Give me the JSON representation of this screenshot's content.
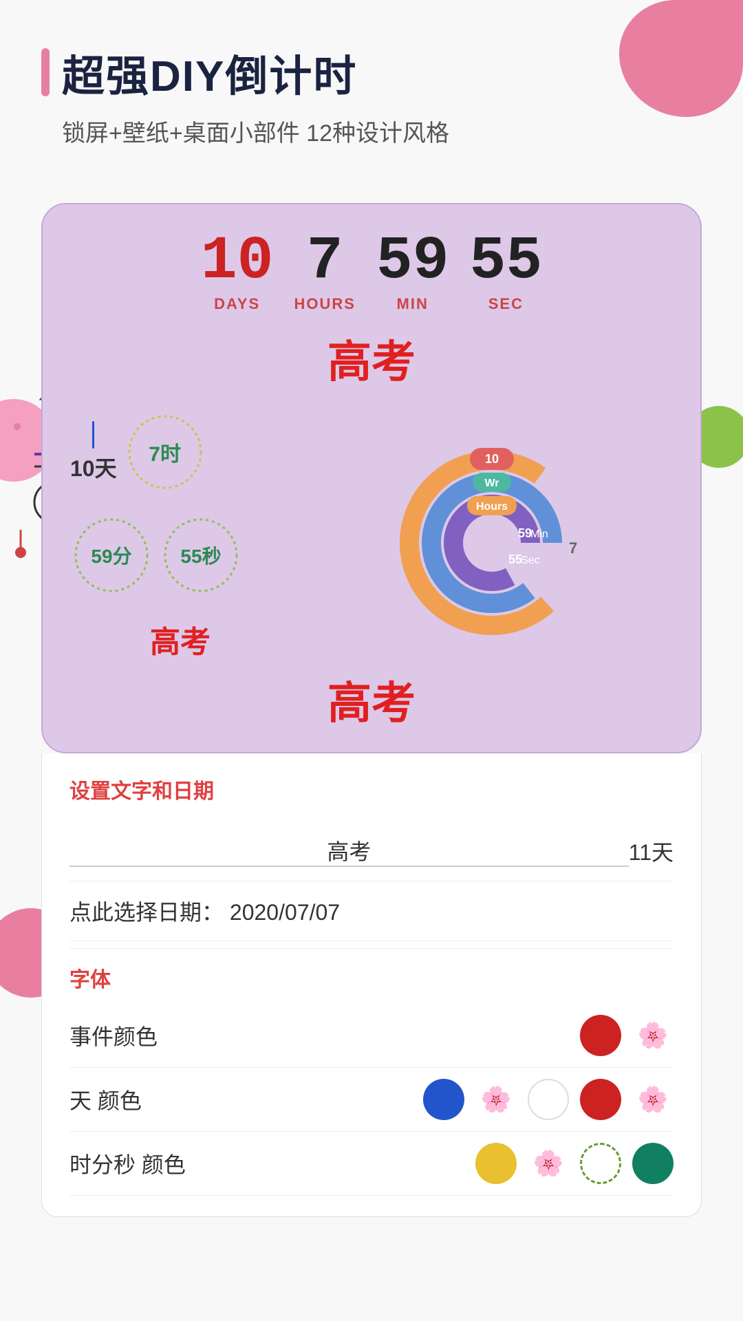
{
  "header": {
    "title": "超强DIY倒计时",
    "subtitle": "锁屏+壁纸+桌面小部件  12种设计风格",
    "accent_color": "#e87fa0"
  },
  "timer": {
    "days_value": "10",
    "days_label": "DAYS",
    "hours_value": "7",
    "hours_label": "HOURS",
    "min_value": "59",
    "min_label": "MIN",
    "sec_value": "55",
    "sec_label": "SEC",
    "event_name": "高考"
  },
  "widget_left": {
    "days_text": "10天",
    "hours_text": "7时",
    "min_text": "59分",
    "sec_text": "55秒",
    "event_name": "高考"
  },
  "donut_chart": {
    "labels": [
      "10",
      "Wr",
      "Hours",
      "59 Min",
      "55 Sec"
    ],
    "colors": [
      "#e06060",
      "#4db8a0",
      "#f0a050",
      "#6090d8",
      "#8060c0"
    ]
  },
  "widget_bottom": {
    "event_name": "高考"
  },
  "settings": {
    "section_title": "设置文字和日期",
    "event_input_value": "高考",
    "days_count": "11天",
    "date_label": "点此选择日期：",
    "date_value": "2020/07/07",
    "font_section_title": "字体",
    "rows": [
      {
        "label": "事件颜色",
        "color": "#cc2222",
        "has_pattern": true
      },
      {
        "label": "天 颜色",
        "colors": [
          "#2255cc",
          "#c86090",
          "#ffffff",
          "#cc2222",
          "#c86090"
        ],
        "has_patterns": true
      },
      {
        "label": "时分秒 颜色",
        "colors": [
          "#e8c030",
          "#c86090",
          "#8bc34a",
          "#108060"
        ],
        "has_patterns": true
      }
    ]
  },
  "colors": {
    "red": "#cc2222",
    "blue": "#2255cc",
    "yellow": "#e8c030",
    "green": "#108060",
    "white": "#ffffff",
    "pink": "#c86090",
    "lime": "#8bc34a"
  }
}
